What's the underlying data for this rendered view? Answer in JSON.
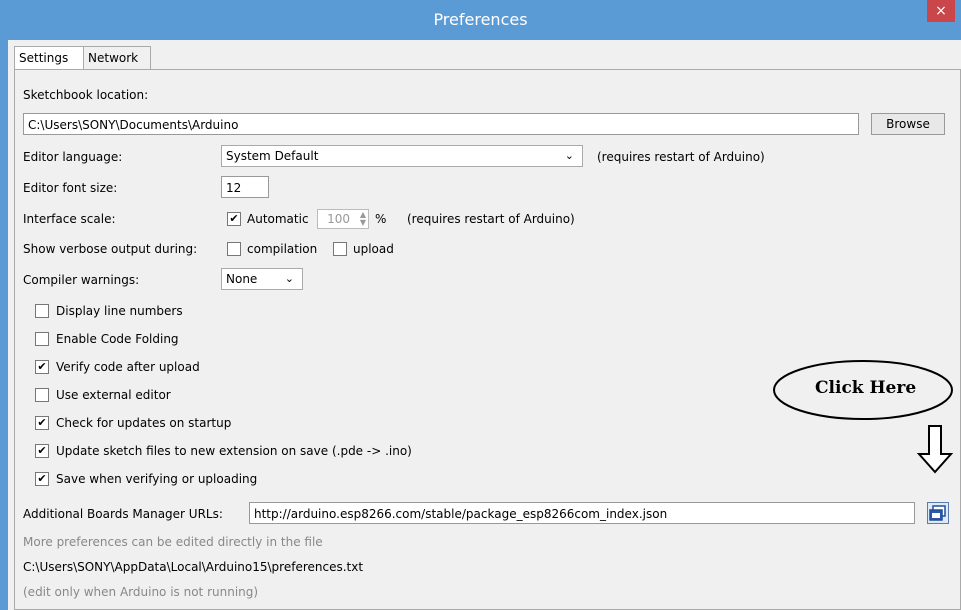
{
  "window": {
    "title": "Preferences",
    "close_label": "×"
  },
  "tabs": [
    {
      "label": "Settings"
    },
    {
      "label": "Network"
    }
  ],
  "sketchbook": {
    "label": "Sketchbook location:",
    "value": "C:\\Users\\SONY\\Documents\\Arduino",
    "browse_label": "Browse"
  },
  "language": {
    "label": "Editor language:",
    "value": "System Default",
    "note": "(requires restart of Arduino)"
  },
  "font_size": {
    "label": "Editor font size:",
    "value": "12"
  },
  "scale": {
    "label": "Interface scale:",
    "auto_label": "Automatic",
    "auto_checked": true,
    "value": "100",
    "unit": "%",
    "note": "(requires restart of Arduino)"
  },
  "verbose": {
    "label": "Show verbose output during:",
    "compilation_label": "compilation",
    "upload_label": "upload"
  },
  "warnings": {
    "label": "Compiler warnings:",
    "value": "None"
  },
  "options": [
    {
      "label": "Display line numbers",
      "checked": false
    },
    {
      "label": "Enable Code Folding",
      "checked": false
    },
    {
      "label": "Verify code after upload",
      "checked": true
    },
    {
      "label": "Use external editor",
      "checked": false
    },
    {
      "label": "Check for updates on startup",
      "checked": true
    },
    {
      "label": "Update sketch files to new extension on save (.pde -> .ino)",
      "checked": true
    },
    {
      "label": "Save when verifying or uploading",
      "checked": true
    }
  ],
  "boards_urls": {
    "label": "Additional Boards Manager URLs:",
    "value": "http://arduino.esp8266.com/stable/package_esp8266com_index.json"
  },
  "footer": {
    "line1": "More preferences can be edited directly in the file",
    "path": "C:\\Users\\SONY\\AppData\\Local\\Arduino15\\preferences.txt",
    "line3": "(edit only when Arduino is not running)"
  },
  "annotation": {
    "text": "Click Here"
  },
  "check_mark": "✔",
  "colors": {
    "titlebar": "#5b9bd5",
    "close": "#c9464a"
  }
}
